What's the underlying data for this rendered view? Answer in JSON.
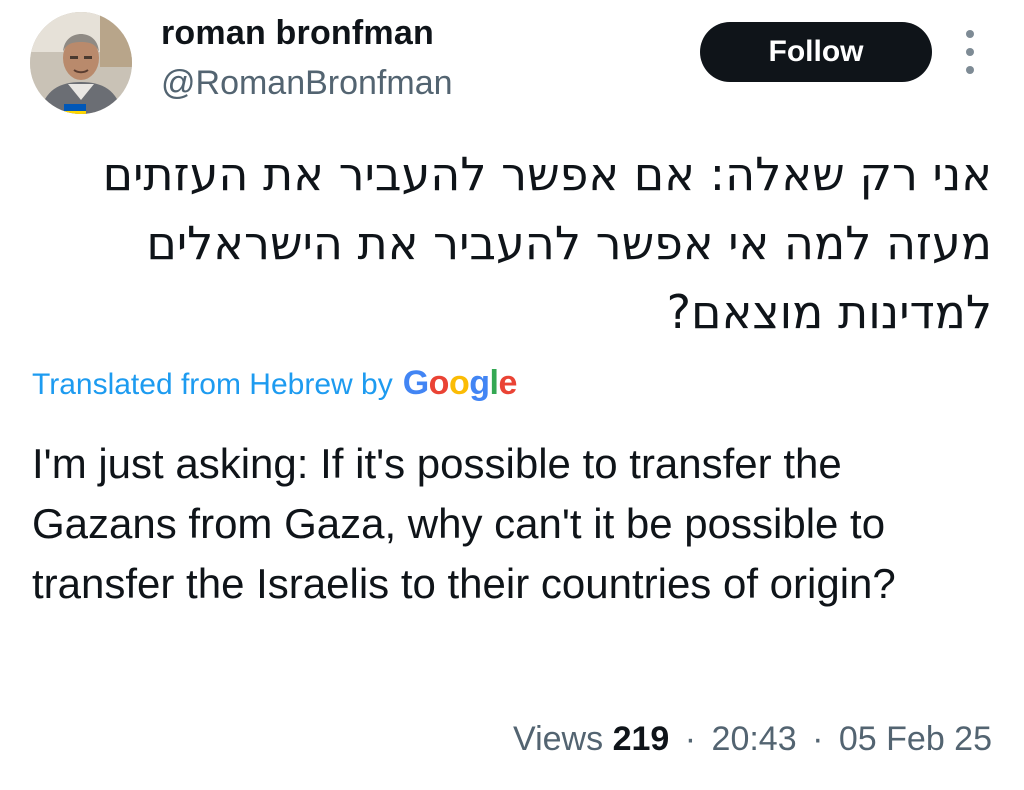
{
  "author": {
    "name": "roman bronfman",
    "handle": "@RomanBronfman"
  },
  "actions": {
    "follow_label": "Follow",
    "more_icon": "more-vertical-icon"
  },
  "tweet": {
    "hebrew_text": "אני רק שאלה: אם אפשר להעביר את העזתים מעזה למה אי אפשר להעביר את הישראלים למדינות מוצאם?",
    "translated_from": "Translated from Hebrew by",
    "google_logo_text": "Google",
    "translation": "I'm just asking: If it's possible to transfer the Gazans from Gaza, why can't it be possible to transfer the Israelis to their countries of origin?"
  },
  "meta": {
    "views_label": "Views",
    "views_count": "219",
    "separator": "·",
    "time": "20:43",
    "date": "05 Feb 25"
  },
  "colors": {
    "accent": "#1d9bf0",
    "text_primary": "#0f1419",
    "text_secondary": "#536471",
    "button_bg": "#0f1419",
    "google_blue": "#4285f4",
    "google_red": "#ea4335",
    "google_yellow": "#fbbc05",
    "google_green": "#34a853"
  }
}
